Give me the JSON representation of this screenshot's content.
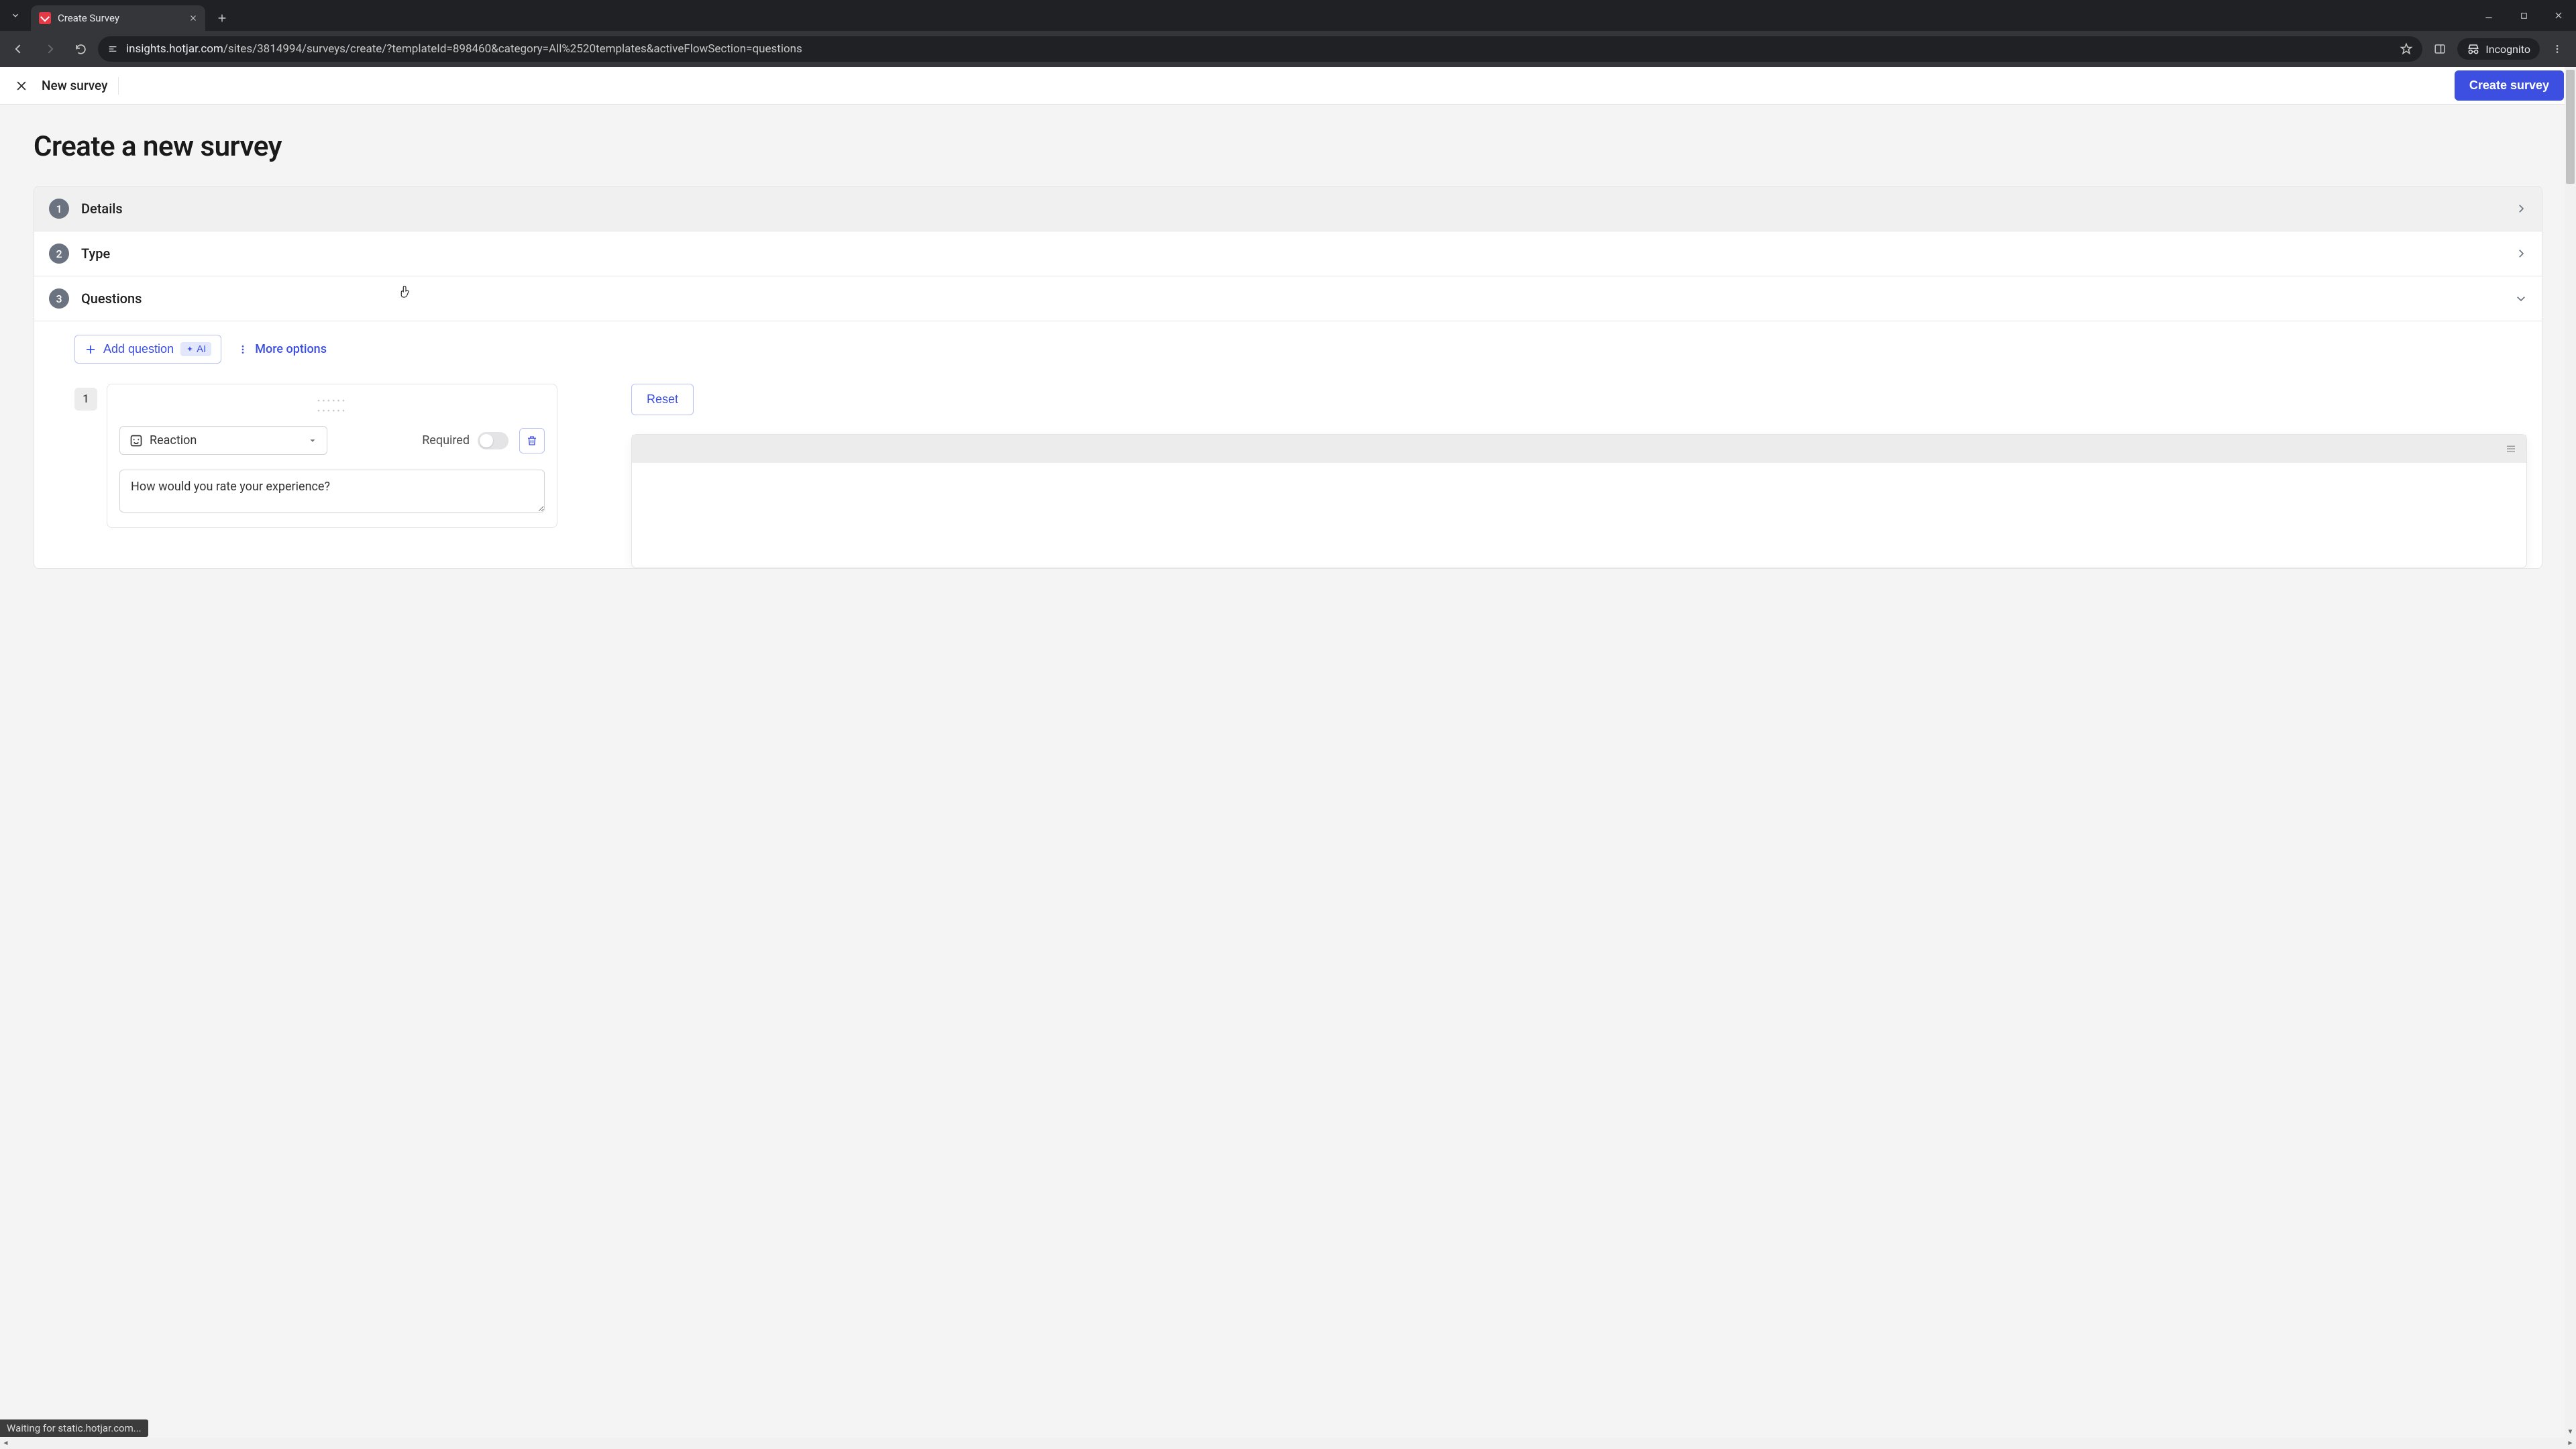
{
  "browser": {
    "tab_title": "Create Survey",
    "url_host": "insights.hotjar.com",
    "url_path": "/sites/3814994/surveys/create/?templateId=898460&category=All%2520templates&activeFlowSection=questions",
    "incognito_label": "Incognito"
  },
  "header": {
    "title": "New survey",
    "create_button": "Create survey"
  },
  "page": {
    "heading": "Create a new survey"
  },
  "steps": {
    "details": {
      "num": "1",
      "label": "Details"
    },
    "type": {
      "num": "2",
      "label": "Type"
    },
    "questions": {
      "num": "3",
      "label": "Questions"
    }
  },
  "toolbar": {
    "add_question": "Add question",
    "ai_chip": "AI",
    "more_options": "More options"
  },
  "question1": {
    "index": "1",
    "type_label": "Reaction",
    "required_label": "Required",
    "text": "How would you rate your experience?"
  },
  "preview": {
    "reset_label": "Reset"
  },
  "status_bar": "Waiting for static.hotjar.com..."
}
